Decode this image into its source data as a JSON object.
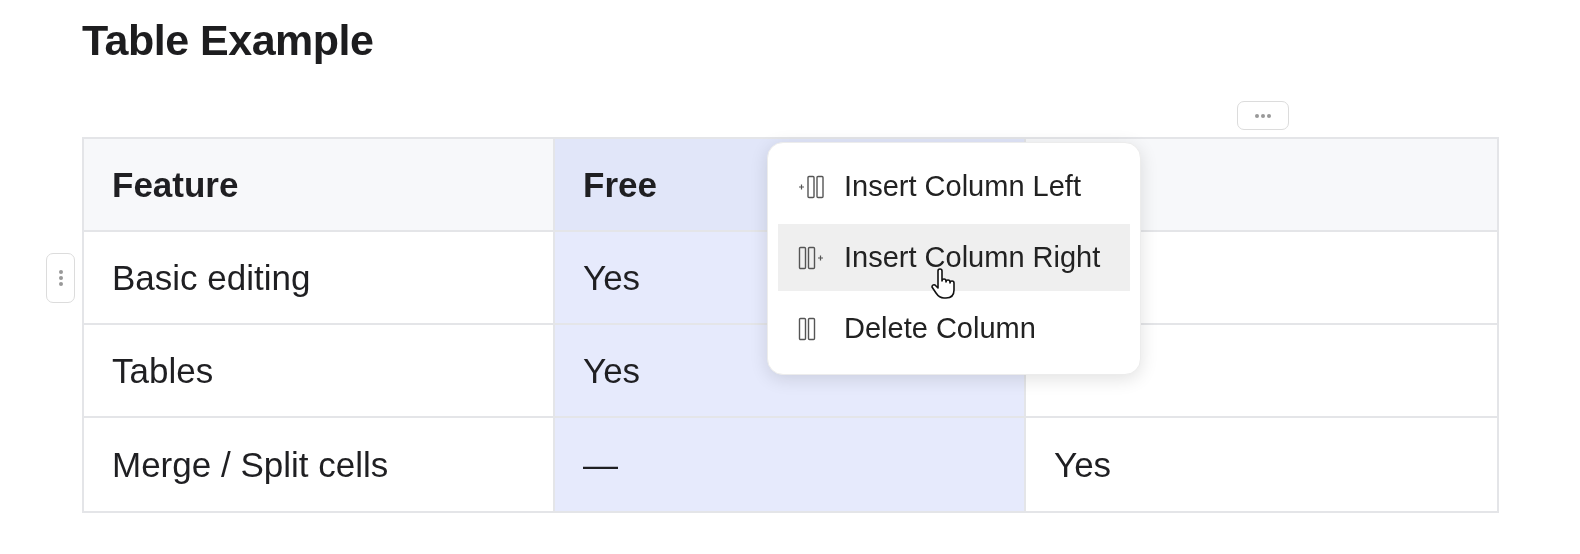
{
  "title": "Table Example",
  "table": {
    "columns": [
      {
        "label": "Feature",
        "selected": false
      },
      {
        "label": "Free",
        "selected": true
      },
      {
        "selected": false
      }
    ],
    "rows": [
      {
        "cells": [
          "Basic editing",
          "Yes",
          null
        ]
      },
      {
        "cells": [
          "Tables",
          "Yes",
          null
        ]
      },
      {
        "cells": [
          "Merge / Split cells",
          "—",
          "Yes"
        ]
      }
    ]
  },
  "context_menu": {
    "items": [
      {
        "kind": "insert-left",
        "label": "Insert Column Left",
        "selected": false
      },
      {
        "kind": "insert-right",
        "label": "Insert Column Right",
        "selected": true
      },
      {
        "kind": "delete",
        "label": "Delete Column",
        "selected": false
      }
    ]
  }
}
